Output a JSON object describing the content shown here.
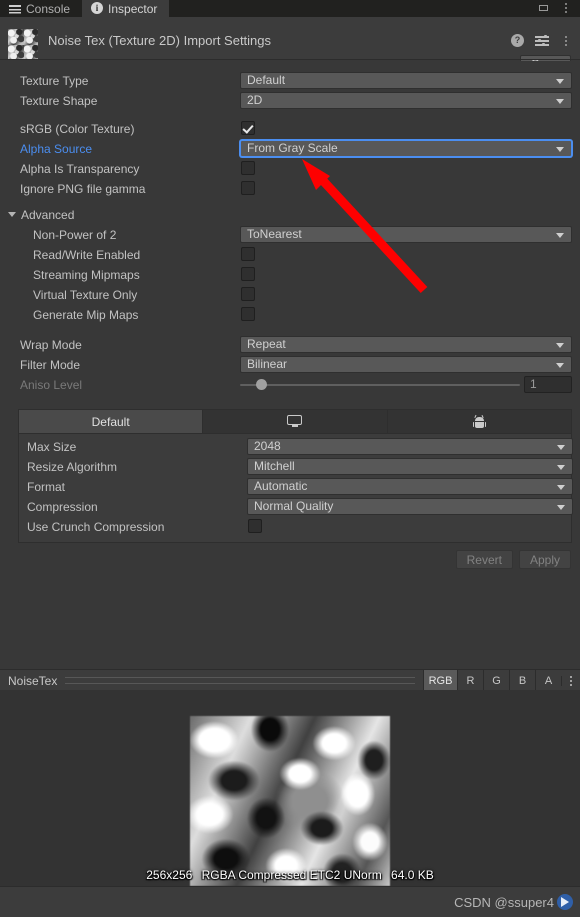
{
  "window": {
    "tabs": [
      {
        "label": "Console",
        "icon": "console-icon",
        "active": false
      },
      {
        "label": "Inspector",
        "icon": "inspector-icon",
        "active": true
      }
    ],
    "maximize_icon": "maximize-icon",
    "menu_icon": "kebab-menu-icon"
  },
  "header": {
    "title": "Noise Tex (Texture 2D) Import Settings",
    "thumbnail_icon": "texture-thumbnail",
    "help_icon": "help-icon",
    "preset_icon": "preset-settings-icon",
    "menu_icon": "kebab-menu-icon",
    "open_button": "Open"
  },
  "settings": {
    "texture_type": {
      "label": "Texture Type",
      "value": "Default"
    },
    "texture_shape": {
      "label": "Texture Shape",
      "value": "2D"
    },
    "srgb": {
      "label": "sRGB (Color Texture)",
      "checked": true
    },
    "alpha_source": {
      "label": "Alpha Source",
      "value": "From Gray Scale",
      "highlighted": true
    },
    "alpha_is_transparency": {
      "label": "Alpha Is Transparency",
      "checked": false
    },
    "ignore_png_gamma": {
      "label": "Ignore PNG file gamma",
      "checked": false
    }
  },
  "advanced": {
    "title": "Advanced",
    "non_power_of_2": {
      "label": "Non-Power of 2",
      "value": "ToNearest"
    },
    "read_write_enabled": {
      "label": "Read/Write Enabled",
      "checked": false
    },
    "streaming_mipmaps": {
      "label": "Streaming Mipmaps",
      "checked": false
    },
    "virtual_texture_only": {
      "label": "Virtual Texture Only",
      "checked": false
    },
    "generate_mip_maps": {
      "label": "Generate Mip Maps",
      "checked": false
    }
  },
  "sampling": {
    "wrap_mode": {
      "label": "Wrap Mode",
      "value": "Repeat"
    },
    "filter_mode": {
      "label": "Filter Mode",
      "value": "Bilinear"
    },
    "aniso_level": {
      "label": "Aniso Level",
      "value": "1",
      "disabled": true
    }
  },
  "platform": {
    "tabs": [
      {
        "label": "Default",
        "icon": "",
        "active": true
      },
      {
        "label": "",
        "icon": "monitor-icon",
        "active": false
      },
      {
        "label": "",
        "icon": "android-icon",
        "active": false
      }
    ],
    "max_size": {
      "label": "Max Size",
      "value": "2048"
    },
    "resize_algorithm": {
      "label": "Resize Algorithm",
      "value": "Mitchell"
    },
    "format": {
      "label": "Format",
      "value": "Automatic"
    },
    "compression": {
      "label": "Compression",
      "value": "Normal Quality"
    },
    "use_crunch_compression": {
      "label": "Use Crunch Compression",
      "checked": false
    }
  },
  "footer": {
    "revert": "Revert",
    "apply": "Apply"
  },
  "preview": {
    "title": "NoiseTex",
    "channels": [
      {
        "label": "RGB",
        "active": true
      },
      {
        "label": "R",
        "active": false
      },
      {
        "label": "G",
        "active": false
      },
      {
        "label": "B",
        "active": false
      },
      {
        "label": "A",
        "active": false
      }
    ],
    "menu_icon": "kebab-menu-icon",
    "info": {
      "dimensions": "256x256",
      "format": "RGBA Compressed ETC2 UNorm",
      "size": "64.0 KB"
    }
  },
  "status": {
    "watermark": "CSDN @ssuper4",
    "badge_icon": "play-badge-icon"
  },
  "annotation": {
    "arrow_color": "#fe0000"
  }
}
